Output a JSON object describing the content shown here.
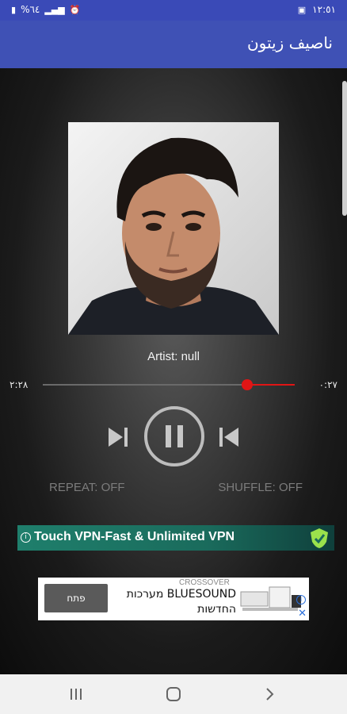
{
  "status_bar": {
    "battery_text": "%٦٤",
    "time": "١٢:٥١"
  },
  "app_bar": {
    "title": "ناصيف زيتون"
  },
  "player": {
    "artist_label": "Artist: null",
    "elapsed_time": "٠:٢٧",
    "total_time": "٢:٢٨",
    "progress_fraction": 0.19,
    "repeat_label": "REPEAT: OFF",
    "shuffle_label": "SHUFFLE: OFF",
    "seek_color": "#e01515"
  },
  "ads": {
    "banner1_text": "Touch VPN-Fast & Unlimited VPN",
    "banner1_info": "i",
    "banner2_brand": "CROSSOVER",
    "banner2_headline": "BLUESOUND מערכות החדשות",
    "banner2_button": "פתח",
    "banner2_info": "i",
    "banner2_close": "✕"
  },
  "icons": {
    "play_pause": "pause-icon",
    "next": "skip-next-icon",
    "previous": "skip-previous-icon"
  }
}
